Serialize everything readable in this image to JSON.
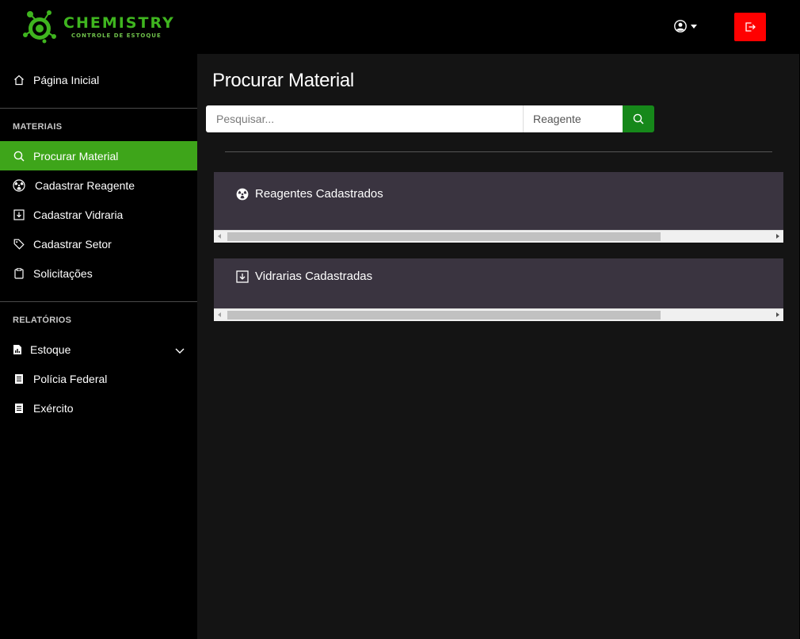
{
  "brand": {
    "title": "CHEMISTRY",
    "subtitle": "CONTROLE DE ESTOQUE",
    "color": "#3fb51f"
  },
  "header": {
    "user_icon": "user-circle-icon",
    "logout_icon": "logout-icon",
    "logout_color": "#ff0000"
  },
  "sidebar": {
    "home": {
      "label": "Página Inicial",
      "icon": "home-icon"
    },
    "sections": [
      {
        "title": "MATERIAIS",
        "items": [
          {
            "label": "Procurar Material",
            "icon": "search-icon",
            "active": true
          },
          {
            "label": "Cadastrar Reagente",
            "icon": "radiation-icon"
          },
          {
            "label": "Cadastrar Vidraria",
            "icon": "download-box-icon"
          },
          {
            "label": "Cadastrar Setor",
            "icon": "tag-icon"
          },
          {
            "label": "Solicitações",
            "icon": "clipboard-icon"
          }
        ]
      },
      {
        "title": "RELATÓRIOS",
        "items": [
          {
            "label": "Estoque",
            "icon": "chart-file-icon",
            "expandable": true
          },
          {
            "label": "Polícia Federal",
            "icon": "document-icon"
          },
          {
            "label": "Exército",
            "icon": "document-icon"
          }
        ]
      }
    ],
    "active_color": "#3ea51a"
  },
  "main": {
    "title": "Procurar Material",
    "search": {
      "placeholder": "Pesquisar...",
      "value": "",
      "type_selected": "Reagente",
      "button_color": "#16881a"
    },
    "cards": [
      {
        "title": "Reagentes Cadastrados",
        "icon": "radiation-icon"
      },
      {
        "title": "Vidrarias Cadastradas",
        "icon": "download-box-icon"
      }
    ]
  }
}
